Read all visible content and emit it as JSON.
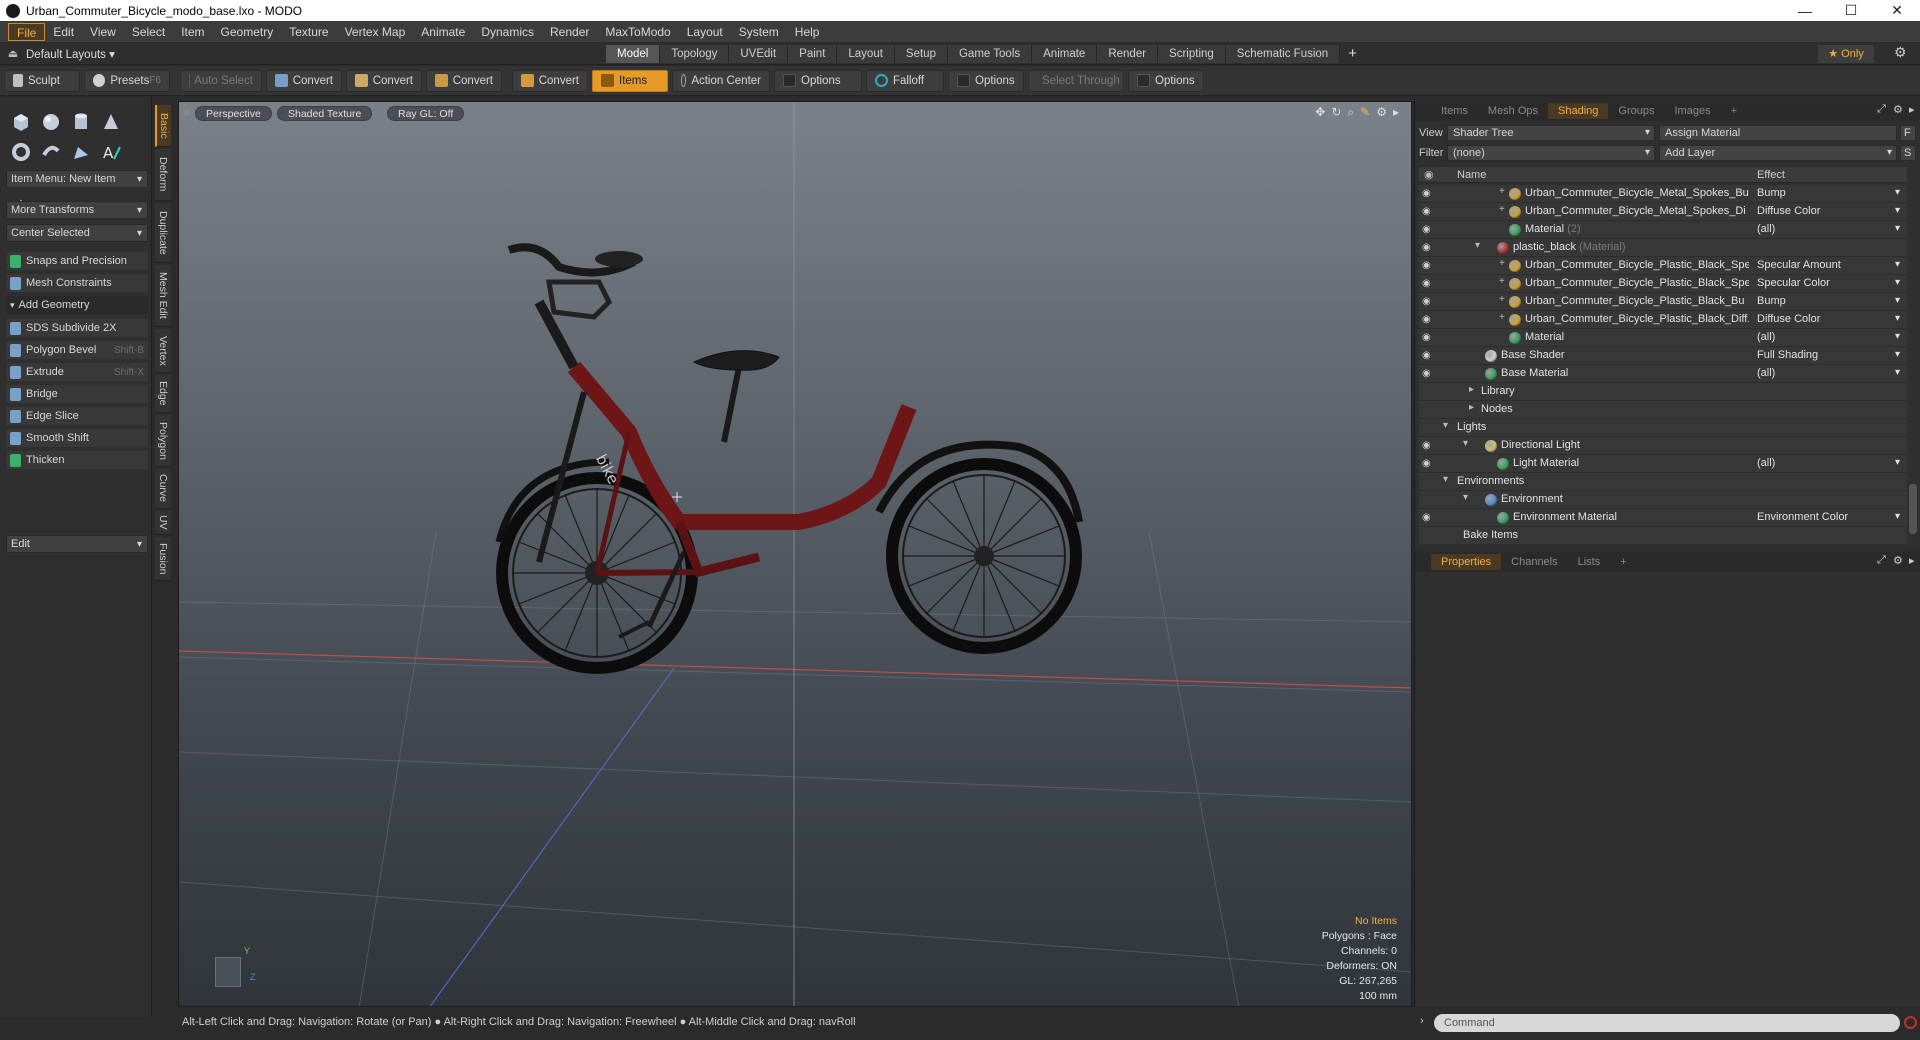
{
  "window": {
    "title": "Urban_Commuter_Bicycle_modo_base.lxo - MODO",
    "controls": [
      "—",
      "☐",
      "✕"
    ]
  },
  "menubar": {
    "items": [
      "File",
      "Edit",
      "View",
      "Select",
      "Item",
      "Geometry",
      "Texture",
      "Vertex Map",
      "Animate",
      "Dynamics",
      "Render",
      "MaxToModo",
      "Layout",
      "System",
      "Help"
    ]
  },
  "layoutbar": {
    "default_layouts": "Default Layouts",
    "tabs": [
      "Model",
      "Topology",
      "UVEdit",
      "Paint",
      "Layout",
      "Setup",
      "Game Tools",
      "Animate",
      "Render",
      "Scripting",
      "Schematic Fusion"
    ],
    "active_tab": "Model",
    "add_label": "+",
    "only_label": "Only"
  },
  "toolbar": {
    "sculpt": "Sculpt",
    "presets": "Presets",
    "presets_shortcut": "F6",
    "auto_select": "Auto Select",
    "convert1": "Convert",
    "convert2": "Convert",
    "convert3": "Convert",
    "convert4": "Convert",
    "items": "Items",
    "action_center": "Action Center",
    "options1": "Options",
    "falloff": "Falloff",
    "options2": "Options",
    "select_through": "Select Through",
    "options3": "Options"
  },
  "leftpanel": {
    "item_menu": "Item Menu: New Item",
    "more_transforms": "More Transforms",
    "center_selected": "Center Selected",
    "snaps": "Snaps and Precision",
    "mesh_constraints": "Mesh Constraints",
    "add_geometry": "Add Geometry",
    "tools": [
      {
        "label": "SDS Subdivide 2X",
        "shortcut": ""
      },
      {
        "label": "Polygon Bevel",
        "shortcut": "Shift-B"
      },
      {
        "label": "Extrude",
        "shortcut": "Shift-X"
      },
      {
        "label": "Bridge",
        "shortcut": ""
      },
      {
        "label": "Edge Slice",
        "shortcut": ""
      },
      {
        "label": "Smooth Shift",
        "shortcut": ""
      },
      {
        "label": "Thicken",
        "shortcut": ""
      }
    ],
    "edit": "Edit",
    "vtabs": [
      "Basic",
      "Deform",
      "Duplicate",
      "Mesh Edit",
      "Vertex",
      "Edge",
      "Polygon",
      "Curve",
      "UV",
      "Fusion"
    ]
  },
  "viewport": {
    "perspective": "Perspective",
    "shaded": "Shaded Texture",
    "raygl": "Ray GL: Off",
    "frame_label": "bike",
    "info": {
      "items": "No Items",
      "polygons": "Polygons : Face",
      "channels": "Channels: 0",
      "deformers": "Deformers: ON",
      "gl": "GL: 267,265",
      "scale": "100 mm"
    },
    "axis_y": "Y",
    "axis_z": "Z"
  },
  "shaderpanel": {
    "tabs": [
      "Items",
      "Mesh Ops",
      "Shading",
      "Groups",
      "Images"
    ],
    "active_tab": "Shading",
    "add_tab": "+",
    "view_label": "View",
    "view_value": "Shader Tree",
    "assign_material": "Assign Material",
    "f_btn": "F",
    "filter_label": "Filter",
    "filter_value": "(none)",
    "add_layer": "Add Layer",
    "s_btn": "S",
    "col_name": "Name",
    "col_effect": "Effect",
    "rows": [
      {
        "name": "Urban_Commuter_Bicycle_Metal_Spokes_Bu...",
        "suffix": "",
        "effect": "Bump",
        "indent": 3,
        "kind": "tex"
      },
      {
        "name": "Urban_Commuter_Bicycle_Metal_Spokes_Di ...",
        "suffix": "",
        "effect": "Diffuse Color",
        "indent": 3,
        "kind": "tex"
      },
      {
        "name": "Material",
        "suffix": "(2)",
        "effect": "(all)",
        "indent": 3,
        "kind": "mat"
      },
      {
        "name": "plastic_black",
        "suffix": "(Material)",
        "effect": "",
        "indent": 2,
        "kind": "grp"
      },
      {
        "name": "Urban_Commuter_Bicycle_Plastic_Black_Spe...",
        "suffix": "",
        "effect": "Specular Amount",
        "indent": 3,
        "kind": "tex"
      },
      {
        "name": "Urban_Commuter_Bicycle_Plastic_Black_Spe...",
        "suffix": "",
        "effect": "Specular Color",
        "indent": 3,
        "kind": "tex"
      },
      {
        "name": "Urban_Commuter_Bicycle_Plastic_Black_Bu",
        "suffix": "",
        "effect": "Bump",
        "indent": 3,
        "kind": "tex"
      },
      {
        "name": "Urban_Commuter_Bicycle_Plastic_Black_Diff...",
        "suffix": "",
        "effect": "Diffuse Color",
        "indent": 3,
        "kind": "tex"
      },
      {
        "name": "Material",
        "suffix": "",
        "effect": "(all)",
        "indent": 3,
        "kind": "mat"
      },
      {
        "name": "Base Shader",
        "suffix": "",
        "effect": "Full Shading",
        "indent": 1,
        "kind": "shader"
      },
      {
        "name": "Base Material",
        "suffix": "",
        "effect": "(all)",
        "indent": 1,
        "kind": "mat"
      },
      {
        "name": "Library",
        "suffix": "",
        "effect": "",
        "indent": 1,
        "kind": "folder"
      },
      {
        "name": "Nodes",
        "suffix": "",
        "effect": "",
        "indent": 1,
        "kind": "folder"
      },
      {
        "name": "Lights",
        "suffix": "",
        "effect": "",
        "indent": 0,
        "kind": "section"
      },
      {
        "name": "Directional Light",
        "suffix": "",
        "effect": "",
        "indent": 1,
        "kind": "light"
      },
      {
        "name": "Light Material",
        "suffix": "",
        "effect": "(all)",
        "indent": 2,
        "kind": "mat"
      },
      {
        "name": "Environments",
        "suffix": "",
        "effect": "",
        "indent": 0,
        "kind": "section"
      },
      {
        "name": "Environment",
        "suffix": "",
        "effect": "",
        "indent": 1,
        "kind": "env"
      },
      {
        "name": "Environment Material",
        "suffix": "",
        "effect": "Environment Color",
        "indent": 2,
        "kind": "mat"
      },
      {
        "name": "Bake Items",
        "suffix": "",
        "effect": "",
        "indent": 0,
        "kind": "plain"
      }
    ]
  },
  "propspanel": {
    "tabs": [
      "Properties",
      "Channels",
      "Lists"
    ],
    "active_tab": "Properties",
    "add_tab": "+"
  },
  "statusbar": {
    "text": "Alt-Left Click and Drag: Navigation: Rotate (or Pan) ● Alt-Right Click and Drag: Navigation: Freewheel ● Alt-Middle Click and Drag: navRoll"
  },
  "command": {
    "placeholder": "Command"
  },
  "colors": {
    "accent": "#e69a2a",
    "frame": "#6e1518"
  }
}
